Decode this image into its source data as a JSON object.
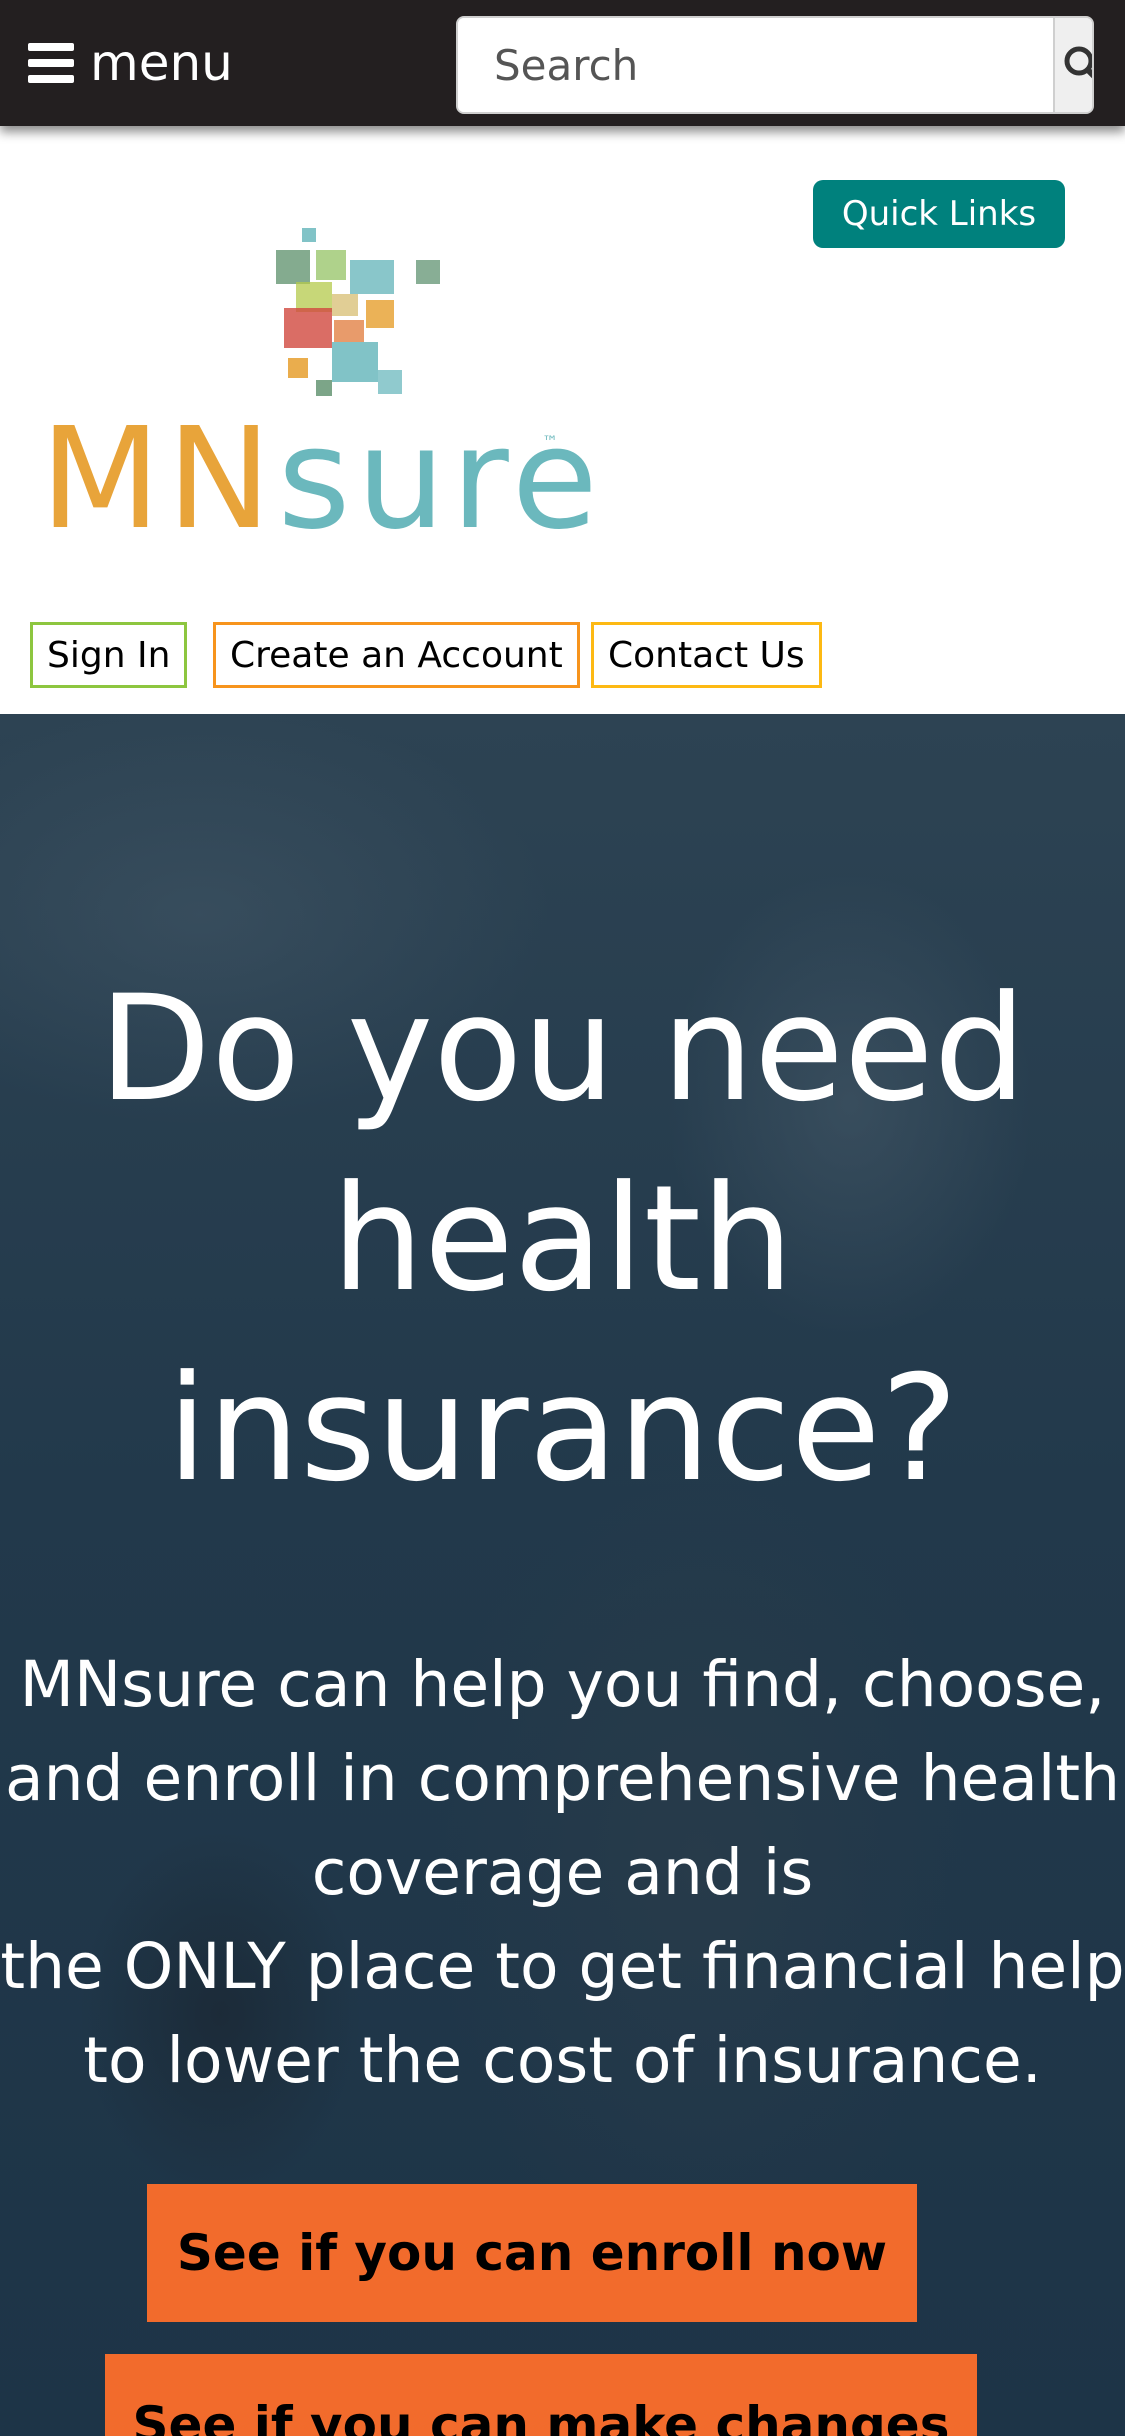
{
  "topbar": {
    "menu_label": "menu",
    "menu_icon": "hamburger-icon",
    "search_placeholder": "Search",
    "search_icon": "search-icon"
  },
  "header": {
    "quick_links_label": "Quick Links",
    "logo": {
      "text_mn": "MN",
      "text_sure": "sure",
      "tm": "™"
    },
    "nav": [
      {
        "label": "Sign In",
        "border_color": "#8dc63f"
      },
      {
        "label": "Create an Account",
        "border_color": "#f7941d"
      },
      {
        "label": "Contact Us",
        "border_color": "#fdb913"
      }
    ]
  },
  "hero": {
    "title": "Do you need health insurance?",
    "body": "MNsure can help you find, choose, and enroll in comprehensive health coverage and is\nthe ONLY place to get financial help to lower the cost of insurance.",
    "cta_primary": "See if you can enroll now",
    "cta_secondary": "See if you can make changes"
  },
  "colors": {
    "topbar_bg": "#231f20",
    "quick_links_bg": "#00817d",
    "cta_bg": "#f26b2c",
    "logo_orange": "#e8a43a",
    "logo_teal": "#6bb8bd",
    "hero_overlay": "#22394b"
  }
}
